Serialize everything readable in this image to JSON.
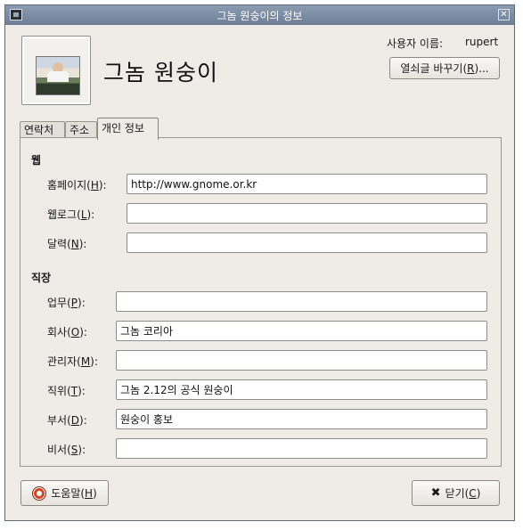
{
  "window": {
    "title": "그놈 원숭이의 정보",
    "close_glyph": "✕"
  },
  "header": {
    "full_name": "그놈 원숭이",
    "username_label": "사용자 이름:",
    "username_value": "rupert",
    "change_password_prefix": "열쇠글 바꾸기(",
    "change_password_mnemonic": "R",
    "change_password_suffix": ")..."
  },
  "tabs": [
    {
      "label": "연락처",
      "active": false
    },
    {
      "label": "주소",
      "active": false
    },
    {
      "label": "개인 정보",
      "active": true
    }
  ],
  "web": {
    "section_title": "웹",
    "homepage": {
      "prefix": "홈페이지(",
      "key": "H",
      "suffix": "):",
      "value": "http://www.gnome.or.kr"
    },
    "weblog": {
      "prefix": "웹로그(",
      "key": "L",
      "suffix": "):",
      "value": ""
    },
    "calendar": {
      "prefix": "달력(",
      "key": "N",
      "suffix": "):",
      "value": ""
    }
  },
  "work": {
    "section_title": "직장",
    "profession": {
      "prefix": "업무(",
      "key": "P",
      "suffix": "):",
      "value": ""
    },
    "company": {
      "prefix": "회사(",
      "key": "O",
      "suffix": "):",
      "value": "그놈 코리아"
    },
    "manager": {
      "prefix": "관리자(",
      "key": "M",
      "suffix": "):",
      "value": ""
    },
    "title": {
      "prefix": "직위(",
      "key": "T",
      "suffix": "):",
      "value": "그놈 2.12의 공식 원숭이"
    },
    "department": {
      "prefix": "부서(",
      "key": "D",
      "suffix": "):",
      "value": "원숭이 홍보"
    },
    "assistant": {
      "prefix": "비서(",
      "key": "S",
      "suffix": "):",
      "value": ""
    }
  },
  "footer": {
    "help_prefix": "도움말(",
    "help_key": "H",
    "help_suffix": ")",
    "close_prefix": "닫기(",
    "close_key": "C",
    "close_suffix": ")"
  },
  "icons": {
    "window_icon": "window-menu-icon",
    "help_icon": "lifebuoy-icon",
    "close_icon": "x-icon",
    "photo": "user-photo"
  }
}
